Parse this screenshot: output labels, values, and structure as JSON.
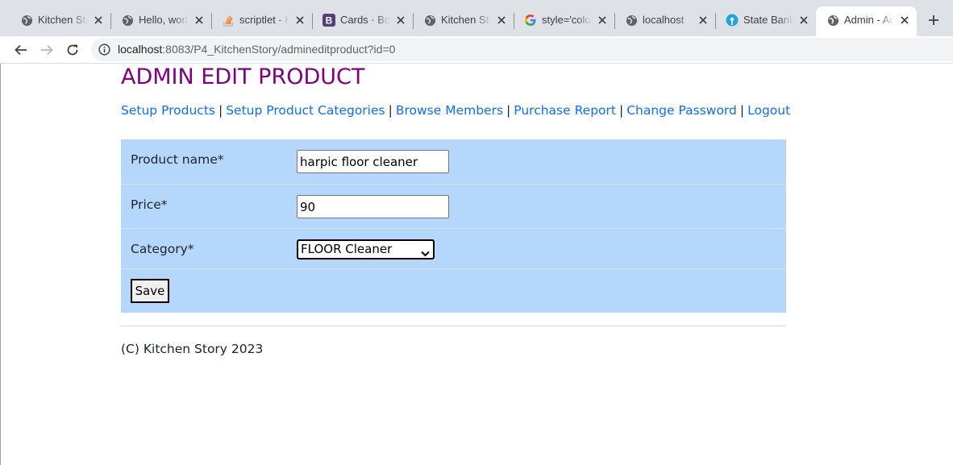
{
  "browser": {
    "tabs": [
      {
        "title": "Kitchen Story",
        "icon": "globe-icon"
      },
      {
        "title": "Hello, world!",
        "icon": "globe-icon"
      },
      {
        "title": "scriptlet - How",
        "icon": "stackoverflow-icon"
      },
      {
        "title": "Cards · Bootstrap",
        "icon": "bootstrap-icon"
      },
      {
        "title": "Kitchen Story",
        "icon": "globe-icon"
      },
      {
        "title": "style='color",
        "icon": "google-icon"
      },
      {
        "title": "localhost",
        "icon": "globe-icon"
      },
      {
        "title": "State Bank",
        "icon": "sbi-icon"
      },
      {
        "title": "Admin - Ad",
        "icon": "globe-icon",
        "active": true
      }
    ],
    "url_host": "localhost",
    "url_rest": ":8083/P4_KitchenStory/admineditproduct?id=0"
  },
  "page": {
    "title": "ADMIN EDIT PRODUCT",
    "nav": [
      "Setup Products",
      "Setup Product Categories",
      "Browse Members",
      "Purchase Report",
      "Change Password",
      "Logout"
    ],
    "separator": "|",
    "form": {
      "name_label": "Product name*",
      "name_value": "harpic floor cleaner",
      "price_label": "Price*",
      "price_value": "90",
      "category_label": "Category*",
      "category_value": "FLOOR Cleaner",
      "save_label": "Save"
    },
    "footer": "(C) Kitchen Story 2023"
  },
  "colors": {
    "title": "#800080",
    "link": "#0d6efd",
    "form_bg": "#b6d7fc"
  }
}
